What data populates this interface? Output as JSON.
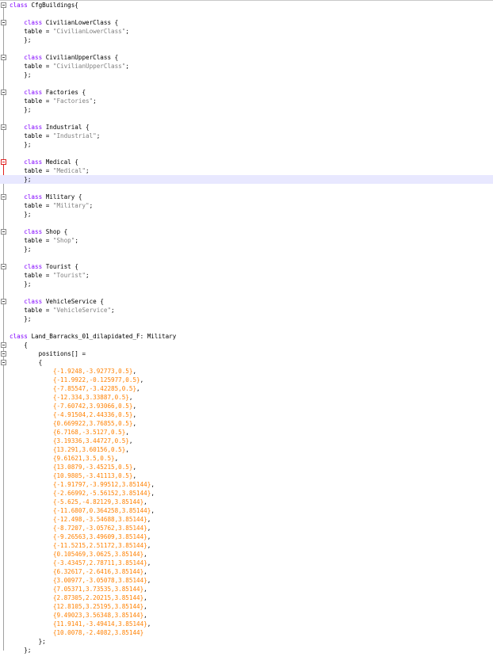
{
  "editor": {
    "cfg_header": "class CfgBuildings{",
    "classes": [
      {
        "name": "CivilianLowerClass",
        "table": "\"CivilianLowerClass\""
      },
      {
        "name": "CivilianUpperClass",
        "table": "\"CivilianUpperClass\""
      },
      {
        "name": "Factories",
        "table": "\"Factories\""
      },
      {
        "name": "Industrial",
        "table": "\"Industrial\""
      },
      {
        "name": "Medical",
        "table": "\"Medical\""
      },
      {
        "name": "Military",
        "table": "\"Military\""
      },
      {
        "name": "Shop",
        "table": "\"Shop\""
      },
      {
        "name": "Tourist",
        "table": "\"Tourist\""
      },
      {
        "name": "VehicleService",
        "table": "\"VehicleService\""
      }
    ],
    "barracks_header": "class Land_Barracks_01_dilapidated_F: Military",
    "positions_label": "positions[] =",
    "positions": [
      "{-1.9248,-3.92773,0.5}",
      "{-11.9922,-0.125977,0.5}",
      "{-7.85547,-3.42285,0.5}",
      "{-12.334,3.33887,0.5}",
      "{-7.60742,3.93066,0.5}",
      "{-4.91504,2.44336,0.5}",
      "{0.669922,3.76855,0.5}",
      "{6.7168,-3.5127,0.5}",
      "{3.19336,3.44727,0.5}",
      "{13.291,3.60156,0.5}",
      "{9.61621,3.5,0.5}",
      "{13.0879,-3.45215,0.5}",
      "{10.9805,-3.41113,0.5}",
      "{-1.91797,-3.99512,3.85144}",
      "{-2.66992,-5.56152,3.85144}",
      "{-5.625,-4.82129,3.85144}",
      "{-11.6807,0.364258,3.85144}",
      "{-12.498,-3.54688,3.85144}",
      "{-8.7207,-3.05762,3.85144}",
      "{-9.26563,3.49609,3.85144}",
      "{-11.5215,2.51172,3.85144}",
      "{0.105469,3.0625,3.85144}",
      "{-3.43457,2.78711,3.85144}",
      "{6.32617,-2.6416,3.85144}",
      "{3.00977,-3.05078,3.85144}",
      "{7.05371,3.73535,3.85144}",
      "{2.87305,2.20215,3.85144}",
      "{12.8105,3.25195,3.85144}",
      "{9.49023,3.56348,3.85144}",
      "{11.9141,-3.49414,3.85144}",
      "{10.0078,-2.4082,3.85144}"
    ]
  }
}
